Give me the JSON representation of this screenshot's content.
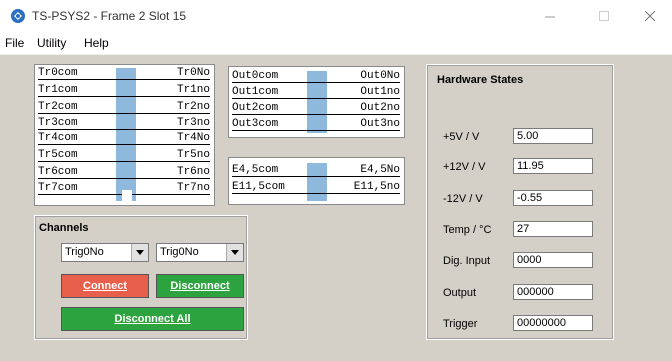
{
  "window": {
    "title": "TS-PSYS2 - Frame 2 Slot 15"
  },
  "menu": {
    "items": [
      "File",
      "Utility",
      "Help"
    ]
  },
  "trig_relays": [
    {
      "com": "Tr0com",
      "no": "Tr0No"
    },
    {
      "com": "Tr1com",
      "no": "Tr1no"
    },
    {
      "com": "Tr2com",
      "no": "Tr2no"
    },
    {
      "com": "Tr3com",
      "no": "Tr3no"
    },
    {
      "com": "Tr4com",
      "no": "Tr4No"
    },
    {
      "com": "Tr5com",
      "no": "Tr5no"
    },
    {
      "com": "Tr6com",
      "no": "Tr6no"
    },
    {
      "com": "Tr7com",
      "no": "Tr7no"
    }
  ],
  "out_relays": [
    {
      "com": "Out0com",
      "no": "Out0No"
    },
    {
      "com": "Out1com",
      "no": "Out1no"
    },
    {
      "com": "Out2com",
      "no": "Out2no"
    },
    {
      "com": "Out3com",
      "no": "Out3no"
    }
  ],
  "e_relays": [
    {
      "com": "E4,5com",
      "no": "E4,5No"
    },
    {
      "com": "E11,5com",
      "no": "E11,5no"
    }
  ],
  "channels": {
    "title": "Channels",
    "combo_a": "Trig0No",
    "combo_b": "Trig0No",
    "connect_label": "Connect",
    "disconnect_label": "Disconnect",
    "disconnect_all_label": "Disconnect All"
  },
  "hardware": {
    "title": "Hardware States",
    "rows": [
      {
        "label": "+5V / V",
        "value": "5.00"
      },
      {
        "label": "+12V / V",
        "value": "11.95"
      },
      {
        "label": "-12V / V",
        "value": "-0.55"
      },
      {
        "label": "Temp / °C",
        "value": "27"
      },
      {
        "label": "Dig. Input",
        "value": "0000"
      },
      {
        "label": "Output",
        "value": "000000"
      },
      {
        "label": "Trigger",
        "value": "00000000"
      }
    ]
  },
  "colors": {
    "relay_blue": "#8fb8dd",
    "connect_red": "#e8604c",
    "disconnect_green": "#2ca33e"
  }
}
